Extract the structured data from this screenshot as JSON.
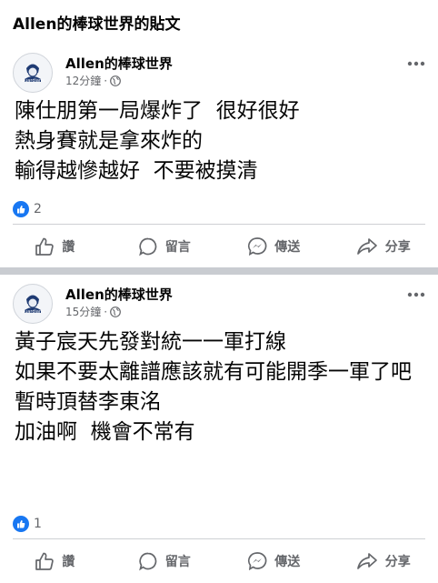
{
  "page": {
    "title": "Allen的棒球世界的貼文"
  },
  "posts": [
    {
      "author": "Allen的棒球世界",
      "time": "12分鐘",
      "dot": "·",
      "content": "陳仕朋第一局爆炸了  很好很好\n熱身賽就是拿來炸的\n輸得越慘越好  不要被摸清",
      "reaction_count": "2",
      "actions": {
        "like": "讚",
        "comment": "留言",
        "send": "傳送",
        "share": "分享"
      }
    },
    {
      "author": "Allen的棒球世界",
      "time": "15分鐘",
      "dot": "·",
      "content": "黃子宸天先發對統一一軍打線\n如果不要太離譜應該就有可能開季一軍了吧\n暫時頂替李東洺\n加油啊  機會不常有",
      "reaction_count": "1",
      "actions": {
        "like": "讚",
        "comment": "留言",
        "send": "傳送",
        "share": "分享"
      }
    }
  ],
  "icons": {
    "avatar": "team-logo-icon",
    "audience": "globe-icon",
    "more": "more-icon",
    "like": "thumbs-up-icon",
    "comment": "comment-icon",
    "send": "messenger-icon",
    "share": "share-arrow-icon"
  },
  "colors": {
    "like_badge": "#1877f2",
    "secondary_text": "#65676b",
    "separator": "#c9ccd1"
  }
}
